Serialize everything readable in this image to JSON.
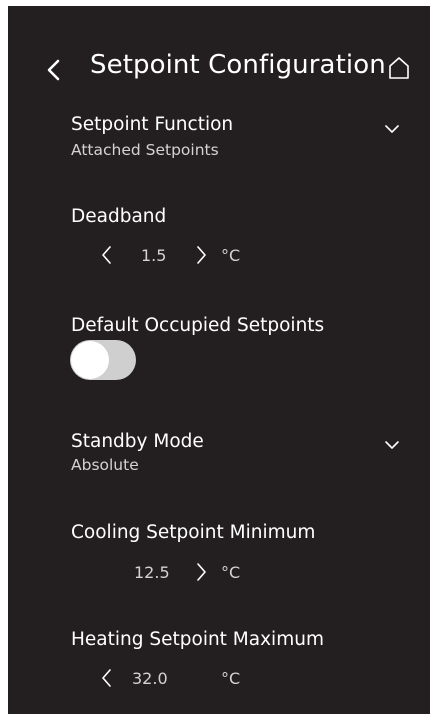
{
  "header": {
    "title": "Setpoint Configuration",
    "back_icon": "chevron-left-icon",
    "home_icon": "home-icon"
  },
  "setpoint_function": {
    "label": "Setpoint Function",
    "value": "Attached Setpoints"
  },
  "deadband": {
    "label": "Deadband",
    "value": "1.5",
    "unit": "°C"
  },
  "default_occupied": {
    "label": "Default Occupied Setpoints",
    "toggle_on": false
  },
  "standby_mode": {
    "label": "Standby Mode",
    "value": "Absolute"
  },
  "cooling_min": {
    "label": "Cooling Setpoint Minimum",
    "value": "12.5",
    "unit": "°C"
  },
  "heating_max": {
    "label": "Heating Setpoint Maximum",
    "value": "32.0",
    "unit": "°C"
  },
  "colors": {
    "background": "#231f20",
    "text": "#ffffff",
    "subtext": "#d4d2d2",
    "toggle_track": "#d0cfd0"
  }
}
